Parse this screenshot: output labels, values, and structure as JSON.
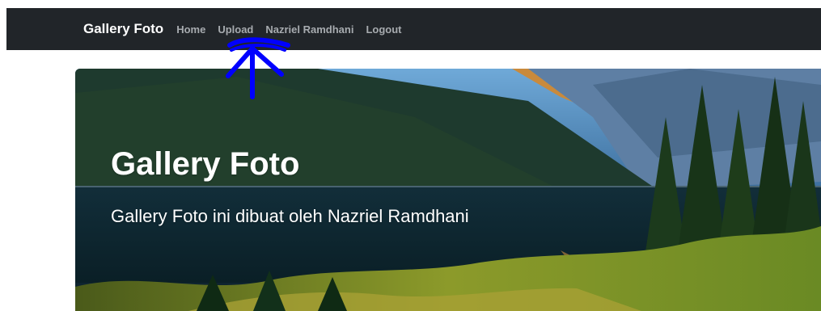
{
  "navbar": {
    "brand": "Gallery Foto",
    "links": [
      {
        "label": "Home"
      },
      {
        "label": "Upload"
      },
      {
        "label": "Nazriel Ramdhani"
      },
      {
        "label": "Logout"
      }
    ]
  },
  "hero": {
    "title": "Gallery Foto",
    "subtitle": "Gallery Foto ini dibuat oleh Nazriel Ramdhani"
  },
  "annotation": {
    "icon": "hand-drawn-arrow-up-icon",
    "color": "#0000ff"
  },
  "colors": {
    "navbar_bg": "#212529",
    "brand": "#ffffff",
    "link": "#a7abaf",
    "hero_text": "#ffffff"
  }
}
